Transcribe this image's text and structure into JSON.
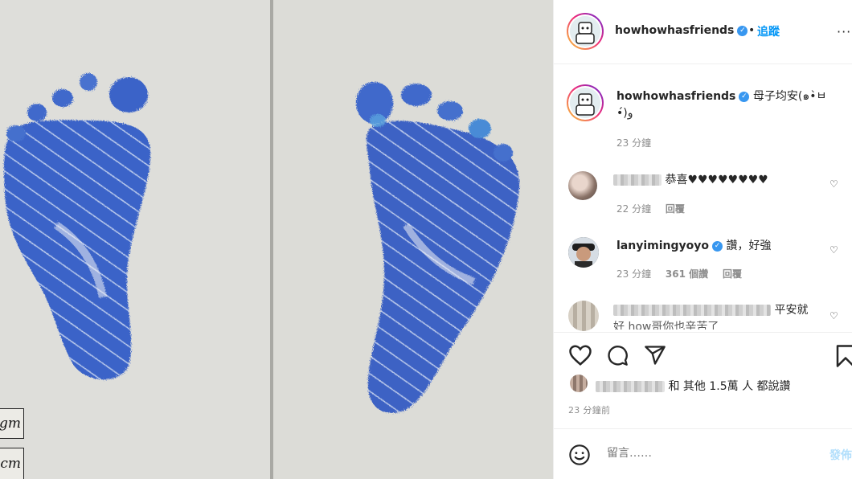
{
  "photo": {
    "card_labels": [
      "gm",
      "cm"
    ]
  },
  "header": {
    "username": "howhowhasfriends",
    "separator": "•",
    "follow_label": "追蹤",
    "more_label": "···"
  },
  "caption": {
    "username": "howhowhasfriends",
    "text": "母子均安(๑•̀ㅂ•́)و",
    "time": "23 分鐘"
  },
  "comments": [
    {
      "text": "恭喜♥♥♥♥♥♥♥♥",
      "time": "22 分鐘",
      "reply_label": "回覆"
    },
    {
      "username": "lanyimingyoyo",
      "text": "讚，好強",
      "time": "23 分鐘",
      "likes": "361 個讚",
      "reply_label": "回覆"
    },
    {
      "text_end": "平安就",
      "text_line2": "好 how哥你也辛苦了"
    }
  ],
  "likes_text": "和 其他 1.5萬 人 都說讚",
  "post_time": "23 分鐘前",
  "comment_box": {
    "placeholder": "留言……",
    "post_label": "發佈"
  },
  "colors": {
    "accent": "#0095f6",
    "ink": "#3a64c8",
    "paper": "#dcdcd8"
  }
}
